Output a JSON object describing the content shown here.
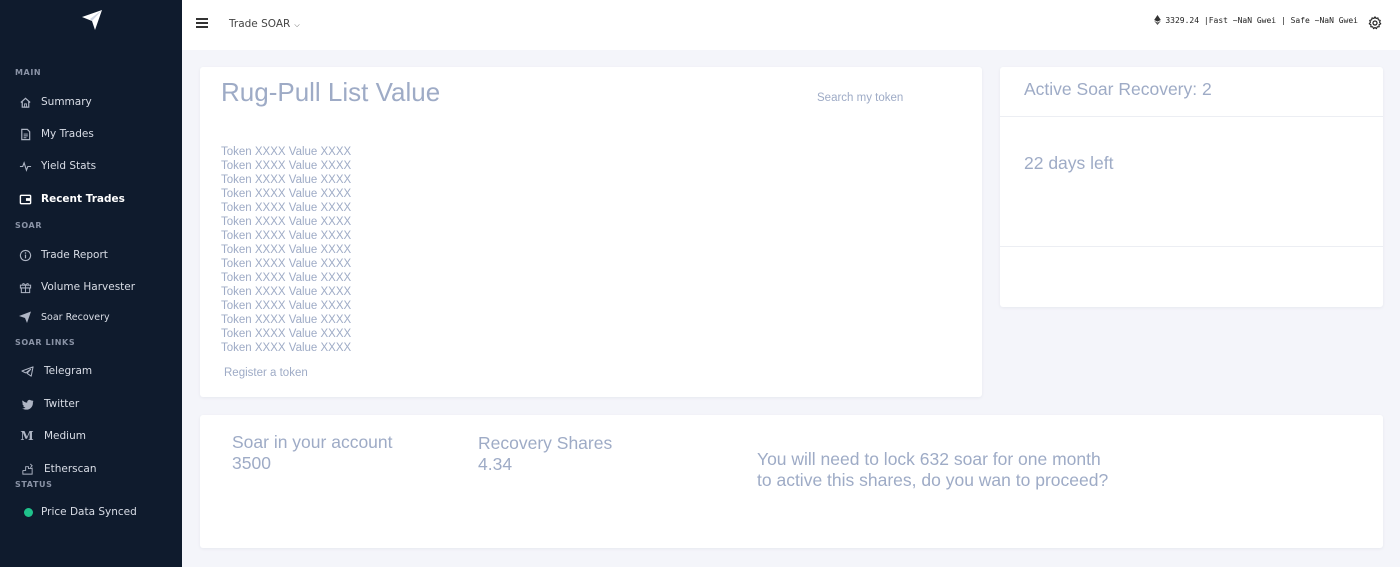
{
  "sidebar": {
    "sections": [
      {
        "title": "MAIN"
      },
      {
        "title": "SOAR"
      },
      {
        "title": "SOAR LINKS"
      },
      {
        "title": "STATUS"
      }
    ],
    "items": [
      {
        "label": "Summary",
        "icon": "home-icon"
      },
      {
        "label": "My Trades",
        "icon": "document-icon"
      },
      {
        "label": "Yield Stats",
        "icon": "pulse-icon"
      },
      {
        "label": "Recent Trades",
        "icon": "wallet-icon"
      },
      {
        "label": "Trade Report",
        "icon": "info-icon"
      },
      {
        "label": "Volume Harvester",
        "icon": "gift-icon"
      },
      {
        "label": "Soar Recovery",
        "icon": "paper-plane-icon"
      },
      {
        "label": "Telegram",
        "icon": "telegram-icon"
      },
      {
        "label": "Twitter",
        "icon": "twitter-icon"
      },
      {
        "label": "Medium",
        "icon": "medium-icon"
      },
      {
        "label": "Etherscan",
        "icon": "etherscan-icon"
      },
      {
        "label": "Price Data Synced",
        "icon": "status-dot-icon"
      }
    ],
    "active_item": "Recent Trades",
    "status_color": "#1fc28b"
  },
  "topbar": {
    "trade_select": "Trade SOAR",
    "gas_info": "3329.24 |Fast ~NaN Gwei | Safe ~NaN Gwei"
  },
  "rug_pull": {
    "title": "Rug-Pull List Value",
    "search_placeholder": "Search my token",
    "tokens": [
      "Token XXXX Value XXXX",
      "Token XXXX Value XXXX",
      "Token XXXX Value XXXX",
      "Token XXXX Value XXXX",
      "Token XXXX Value XXXX",
      "Token XXXX Value XXXX",
      "Token XXXX Value XXXX",
      "Token XXXX Value XXXX",
      "Token XXXX Value XXXX",
      "Token XXXX Value XXXX",
      "Token XXXX Value XXXX",
      "Token XXXX Value XXXX",
      "Token XXXX Value XXXX",
      "Token XXXX Value XXXX",
      "Token XXXX Value XXXX"
    ],
    "register_link": "Register a token"
  },
  "recovery": {
    "title": "Active Soar Recovery: 2",
    "days_left": "22 days left"
  },
  "account": {
    "soar_label": "Soar in your account",
    "soar_value": "3500",
    "shares_label": "Recovery Shares",
    "shares_value": "4.34",
    "message": "You will need to lock 632 soar for one month to active this shares, do you wan to proceed?"
  },
  "colors": {
    "sidebar_bg": "#0f1b2d",
    "muted_text": "#9eabc6",
    "page_bg": "#f4f5fa"
  }
}
